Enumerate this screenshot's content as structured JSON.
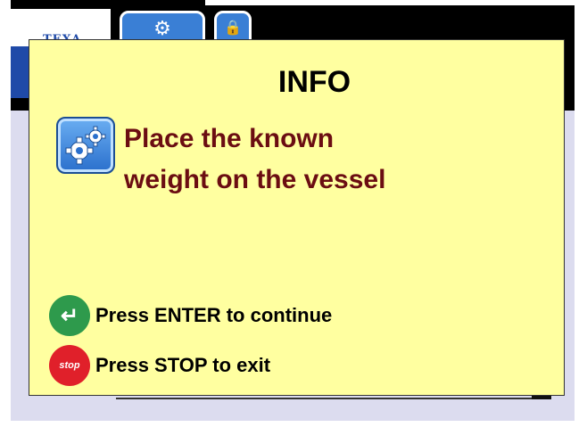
{
  "header": {
    "logo_text": "TEXA",
    "tabs": [
      {
        "icon": "settings-gear-icon"
      },
      {
        "icon": "lock-icon"
      }
    ]
  },
  "dialog": {
    "title": "INFO",
    "icon": "settings-gear-icon",
    "message_line1": "Place the known",
    "message_line2": "weight on the vessel",
    "enter_hint": "Press ENTER to continue",
    "stop_hint": "Press STOP to exit",
    "stop_icon_label": "stop"
  },
  "colors": {
    "dialog_bg": "#ffffa0",
    "message": "#6b0d12",
    "enter": "#2e9a4c",
    "stop": "#e0202a",
    "brand_blue": "#1f4aa8"
  }
}
